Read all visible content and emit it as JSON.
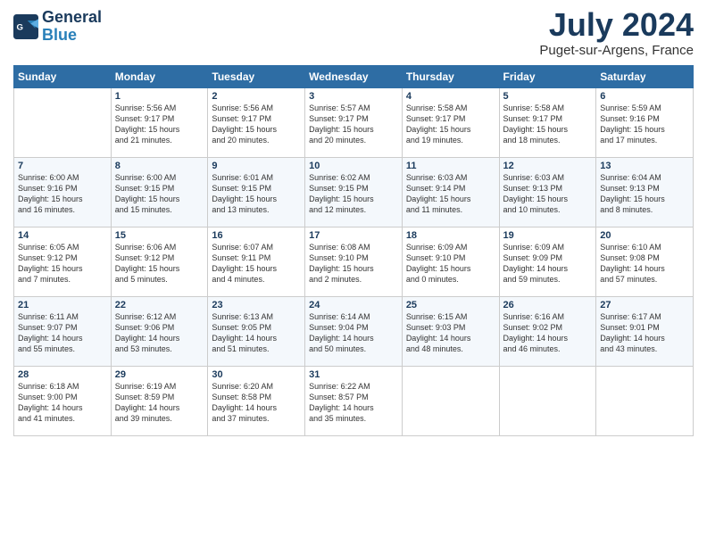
{
  "header": {
    "logo_line1": "General",
    "logo_line2": "Blue",
    "month_year": "July 2024",
    "location": "Puget-sur-Argens, France"
  },
  "days_of_week": [
    "Sunday",
    "Monday",
    "Tuesday",
    "Wednesday",
    "Thursday",
    "Friday",
    "Saturday"
  ],
  "weeks": [
    [
      {
        "day": "",
        "info": ""
      },
      {
        "day": "1",
        "info": "Sunrise: 5:56 AM\nSunset: 9:17 PM\nDaylight: 15 hours\nand 21 minutes."
      },
      {
        "day": "2",
        "info": "Sunrise: 5:56 AM\nSunset: 9:17 PM\nDaylight: 15 hours\nand 20 minutes."
      },
      {
        "day": "3",
        "info": "Sunrise: 5:57 AM\nSunset: 9:17 PM\nDaylight: 15 hours\nand 20 minutes."
      },
      {
        "day": "4",
        "info": "Sunrise: 5:58 AM\nSunset: 9:17 PM\nDaylight: 15 hours\nand 19 minutes."
      },
      {
        "day": "5",
        "info": "Sunrise: 5:58 AM\nSunset: 9:17 PM\nDaylight: 15 hours\nand 18 minutes."
      },
      {
        "day": "6",
        "info": "Sunrise: 5:59 AM\nSunset: 9:16 PM\nDaylight: 15 hours\nand 17 minutes."
      }
    ],
    [
      {
        "day": "7",
        "info": "Sunrise: 6:00 AM\nSunset: 9:16 PM\nDaylight: 15 hours\nand 16 minutes."
      },
      {
        "day": "8",
        "info": "Sunrise: 6:00 AM\nSunset: 9:15 PM\nDaylight: 15 hours\nand 15 minutes."
      },
      {
        "day": "9",
        "info": "Sunrise: 6:01 AM\nSunset: 9:15 PM\nDaylight: 15 hours\nand 13 minutes."
      },
      {
        "day": "10",
        "info": "Sunrise: 6:02 AM\nSunset: 9:15 PM\nDaylight: 15 hours\nand 12 minutes."
      },
      {
        "day": "11",
        "info": "Sunrise: 6:03 AM\nSunset: 9:14 PM\nDaylight: 15 hours\nand 11 minutes."
      },
      {
        "day": "12",
        "info": "Sunrise: 6:03 AM\nSunset: 9:13 PM\nDaylight: 15 hours\nand 10 minutes."
      },
      {
        "day": "13",
        "info": "Sunrise: 6:04 AM\nSunset: 9:13 PM\nDaylight: 15 hours\nand 8 minutes."
      }
    ],
    [
      {
        "day": "14",
        "info": "Sunrise: 6:05 AM\nSunset: 9:12 PM\nDaylight: 15 hours\nand 7 minutes."
      },
      {
        "day": "15",
        "info": "Sunrise: 6:06 AM\nSunset: 9:12 PM\nDaylight: 15 hours\nand 5 minutes."
      },
      {
        "day": "16",
        "info": "Sunrise: 6:07 AM\nSunset: 9:11 PM\nDaylight: 15 hours\nand 4 minutes."
      },
      {
        "day": "17",
        "info": "Sunrise: 6:08 AM\nSunset: 9:10 PM\nDaylight: 15 hours\nand 2 minutes."
      },
      {
        "day": "18",
        "info": "Sunrise: 6:09 AM\nSunset: 9:10 PM\nDaylight: 15 hours\nand 0 minutes."
      },
      {
        "day": "19",
        "info": "Sunrise: 6:09 AM\nSunset: 9:09 PM\nDaylight: 14 hours\nand 59 minutes."
      },
      {
        "day": "20",
        "info": "Sunrise: 6:10 AM\nSunset: 9:08 PM\nDaylight: 14 hours\nand 57 minutes."
      }
    ],
    [
      {
        "day": "21",
        "info": "Sunrise: 6:11 AM\nSunset: 9:07 PM\nDaylight: 14 hours\nand 55 minutes."
      },
      {
        "day": "22",
        "info": "Sunrise: 6:12 AM\nSunset: 9:06 PM\nDaylight: 14 hours\nand 53 minutes."
      },
      {
        "day": "23",
        "info": "Sunrise: 6:13 AM\nSunset: 9:05 PM\nDaylight: 14 hours\nand 51 minutes."
      },
      {
        "day": "24",
        "info": "Sunrise: 6:14 AM\nSunset: 9:04 PM\nDaylight: 14 hours\nand 50 minutes."
      },
      {
        "day": "25",
        "info": "Sunrise: 6:15 AM\nSunset: 9:03 PM\nDaylight: 14 hours\nand 48 minutes."
      },
      {
        "day": "26",
        "info": "Sunrise: 6:16 AM\nSunset: 9:02 PM\nDaylight: 14 hours\nand 46 minutes."
      },
      {
        "day": "27",
        "info": "Sunrise: 6:17 AM\nSunset: 9:01 PM\nDaylight: 14 hours\nand 43 minutes."
      }
    ],
    [
      {
        "day": "28",
        "info": "Sunrise: 6:18 AM\nSunset: 9:00 PM\nDaylight: 14 hours\nand 41 minutes."
      },
      {
        "day": "29",
        "info": "Sunrise: 6:19 AM\nSunset: 8:59 PM\nDaylight: 14 hours\nand 39 minutes."
      },
      {
        "day": "30",
        "info": "Sunrise: 6:20 AM\nSunset: 8:58 PM\nDaylight: 14 hours\nand 37 minutes."
      },
      {
        "day": "31",
        "info": "Sunrise: 6:22 AM\nSunset: 8:57 PM\nDaylight: 14 hours\nand 35 minutes."
      },
      {
        "day": "",
        "info": ""
      },
      {
        "day": "",
        "info": ""
      },
      {
        "day": "",
        "info": ""
      }
    ]
  ]
}
